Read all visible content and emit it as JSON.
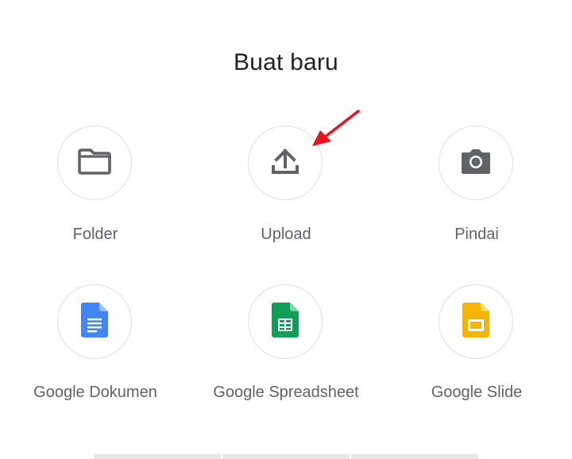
{
  "dialog": {
    "title": "Buat baru"
  },
  "actions": [
    {
      "label": "Folder",
      "icon": "folder-icon"
    },
    {
      "label": "Upload",
      "icon": "upload-icon"
    },
    {
      "label": "Pindai",
      "icon": "camera-icon"
    },
    {
      "label": "Google Dokumen",
      "icon": "google-docs-icon",
      "color": "#4285F4"
    },
    {
      "label": "Google Spreadsheet",
      "icon": "google-sheets-icon",
      "color": "#0F9D58"
    },
    {
      "label": "Google Slide",
      "icon": "google-slides-icon",
      "color": "#F4B400"
    }
  ],
  "annotation": {
    "arrow_color": "#E8141B",
    "points_to": "upload"
  }
}
